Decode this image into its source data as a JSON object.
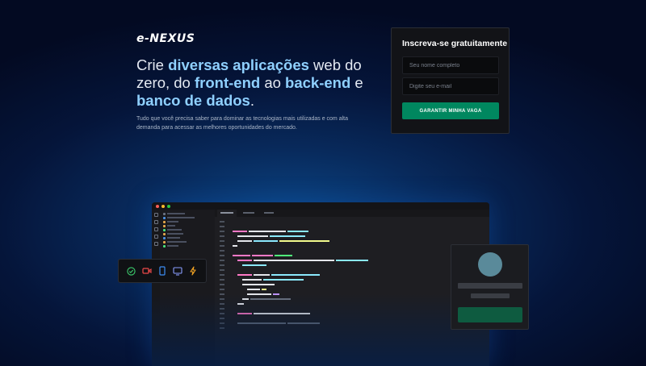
{
  "brand": {
    "logo": "e-NEXUS"
  },
  "hero": {
    "headline_parts": {
      "p1": "Crie ",
      "h1": "diversas aplicações",
      "p2": " web do zero, do ",
      "h2": "front-end",
      "p3": " ao ",
      "h3": "back-end",
      "p4": " e ",
      "h4": "banco de dados",
      "p5": "."
    },
    "subtext": "Tudo que você precisa saber para dominar as tecnologias mais utilizadas e com alta demanda para acessar as melhores oportunidades do mercado."
  },
  "signup": {
    "title": "Inscreva-se gratuitamente",
    "name_placeholder": "Seu nome completo",
    "email_placeholder": "Digite seu e-mail",
    "button_label": "GARANTIR MINHA VAGA"
  },
  "colors": {
    "accent": "#00875f",
    "highlight": "#8fd0ff",
    "background": "#05153a"
  },
  "toolbar": {
    "icons": [
      "check-circle-icon",
      "video-icon",
      "phone-icon",
      "monitor-icon",
      "lightning-icon"
    ],
    "icon_colors": [
      "#3ccf6e",
      "#f04a4a",
      "#3d8ef5",
      "#8a9eff",
      "#f5a524"
    ]
  }
}
